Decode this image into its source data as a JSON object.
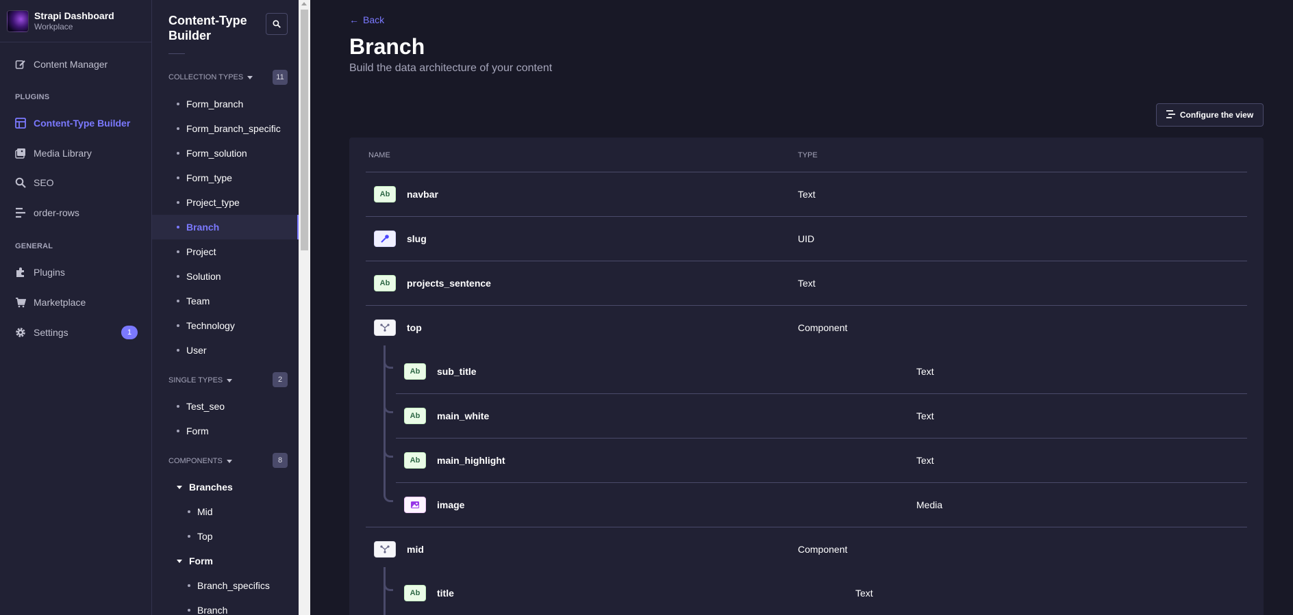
{
  "brand": {
    "title": "Strapi Dashboard",
    "subtitle": "Workplace"
  },
  "mainnav": {
    "content_manager": "Content Manager",
    "plugins_section": "PLUGINS",
    "content_type_builder": "Content-Type Builder",
    "media_library": "Media Library",
    "seo": "SEO",
    "order_rows": "order-rows",
    "general_section": "GENERAL",
    "plugins": "Plugins",
    "marketplace": "Marketplace",
    "settings": "Settings",
    "settings_badge": "1"
  },
  "subnav": {
    "title": "Content-Type Builder",
    "collection_types": {
      "label": "COLLECTION TYPES",
      "count": "11",
      "items": [
        "Form_branch",
        "Form_branch_specific",
        "Form_solution",
        "Form_type",
        "Project_type",
        "Branch",
        "Project",
        "Solution",
        "Team",
        "Technology",
        "User"
      ]
    },
    "single_types": {
      "label": "SINGLE TYPES",
      "count": "2",
      "items": [
        "Test_seo",
        "Form"
      ]
    },
    "components": {
      "label": "COMPONENTS",
      "count": "8",
      "groups": [
        {
          "name": "Branches",
          "items": [
            "Mid",
            "Top"
          ]
        },
        {
          "name": "Form",
          "items": [
            "Branch_specifics",
            "Branch"
          ]
        }
      ]
    }
  },
  "header": {
    "back": "Back",
    "title": "Branch",
    "subtitle": "Build the data architecture of your content",
    "configure_button": "Configure the view"
  },
  "table": {
    "col_name": "NAME",
    "col_type": "TYPE",
    "rows": [
      {
        "icon": "Ab",
        "name": "navbar",
        "type": "Text"
      },
      {
        "icon": "uid",
        "name": "slug",
        "type": "UID"
      },
      {
        "icon": "Ab",
        "name": "projects_sentence",
        "type": "Text"
      },
      {
        "icon": "component",
        "name": "top",
        "type": "Component"
      },
      {
        "icon": "Ab",
        "name": "sub_title",
        "type": "Text"
      },
      {
        "icon": "Ab",
        "name": "main_white",
        "type": "Text"
      },
      {
        "icon": "Ab",
        "name": "main_highlight",
        "type": "Text"
      },
      {
        "icon": "media",
        "name": "image",
        "type": "Media"
      },
      {
        "icon": "component",
        "name": "mid",
        "type": "Component"
      },
      {
        "icon": "Ab",
        "name": "title",
        "type": "Text"
      }
    ]
  },
  "colors": {
    "accent": "#7b79ff",
    "background": "#181826",
    "panel": "#212134"
  }
}
